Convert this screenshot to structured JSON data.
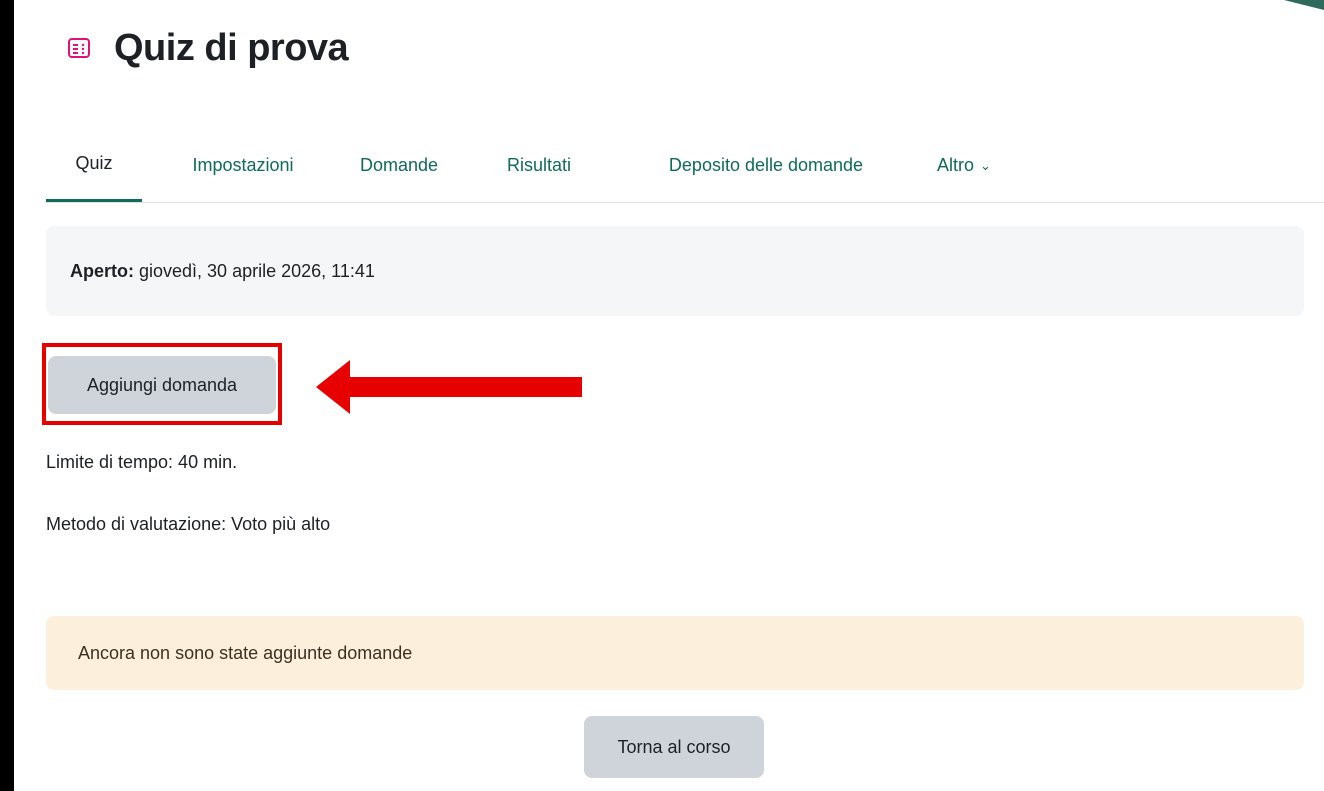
{
  "page": {
    "title": "Quiz di prova",
    "icon": "quiz-icon",
    "accent_color": "#0f6b5a",
    "icon_color": "#e0117c"
  },
  "tabs": [
    {
      "label": "Quiz",
      "active": true
    },
    {
      "label": "Impostazioni",
      "active": false
    },
    {
      "label": "Domande",
      "active": false
    },
    {
      "label": "Risultati",
      "active": false
    },
    {
      "label": "Deposito delle domande",
      "active": false
    },
    {
      "label": "Altro",
      "active": false,
      "icon": "chevron-down-icon"
    }
  ],
  "open_info": {
    "label": "Aperto:",
    "value": "giovedì, 30 aprile 2026, 11:41"
  },
  "actions": {
    "add_question": "Aggiungi domanda",
    "back_to_course": "Torna al corso"
  },
  "quiz_info": {
    "time_limit": "Limite di tempo: 40 min.",
    "grading_method": "Metodo di valutazione: Voto più alto"
  },
  "alert": {
    "message": "Ancora non sono state aggiunte domande"
  },
  "annotation": {
    "highlight_color": "#e60000"
  }
}
